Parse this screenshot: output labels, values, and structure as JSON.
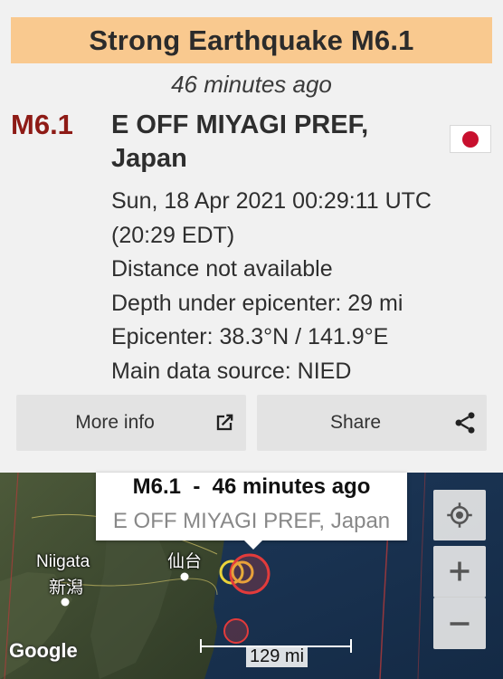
{
  "alert": {
    "banner": "Strong Earthquake M6.1",
    "time_ago": "46 minutes ago",
    "magnitude": "M6.1",
    "region_line1": "E OFF MIYAGI PREF,",
    "region_line2": "Japan",
    "country_flag_icon": "japan-flag-icon",
    "details": [
      "Sun, 18 Apr 2021 00:29:11 UTC",
      "(20:29 EDT)",
      "Distance not available",
      "Depth under epicenter: 29 mi",
      "Epicenter: 38.3°N / 141.9°E",
      "Main data source: NIED"
    ]
  },
  "buttons": {
    "more_info": "More info",
    "more_info_icon": "open-external-icon",
    "share": "Share",
    "share_icon": "share-icon"
  },
  "map": {
    "popup_title": "M6.1  -  46 minutes ago",
    "popup_subtitle": "E OFF MIYAGI PREF, Japan",
    "cities": [
      {
        "name": "Niigata",
        "local": "新潟"
      },
      {
        "name": "仙台",
        "local": ""
      }
    ],
    "attribution": "Google",
    "scale_label": "129 mi",
    "controls": [
      "my-location-icon",
      "zoom-in-icon",
      "zoom-out-icon"
    ]
  },
  "colors": {
    "banner_bg": "#f9c98f",
    "magnitude_text": "#8e1b16",
    "quake_marker": "#e23b3b",
    "quake_marker_older": "#e8d23a"
  }
}
